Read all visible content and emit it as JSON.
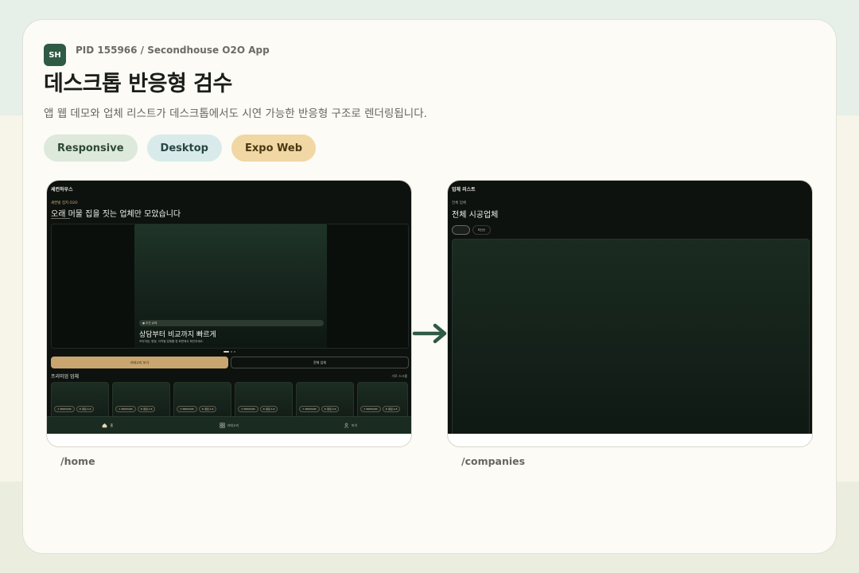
{
  "header": {
    "logo_text": "SH",
    "pid": "PID 155966 / Secondhouse O2O App",
    "title": "데스크톱 반응형 검수",
    "subtitle": "앱 웹 데모와 업체 리스트가 데스크톱에서도 시연 가능한 반응형 구조로 렌더링됩니다."
  },
  "chips": [
    {
      "label": "Responsive",
      "color": "#dde9da"
    },
    {
      "label": "Desktop",
      "color": "#d8ebea"
    },
    {
      "label": "Expo Web",
      "color": "#f0d7a4"
    }
  ],
  "home": {
    "route": "/home",
    "brand": "세컨하우스",
    "kicker": "세컨빌 집지 O2O",
    "headline": "오래 머물 집을 짓는 업체만 모았습니다",
    "hero": {
      "badge": "● 추천 큐레",
      "title": "상담부터 비교까지 빠르게",
      "subtitle": "프리미엄, 평점, 지역별 업체를 한 화면에서 확인하세요."
    },
    "buttons": {
      "category": "카테고리 보기",
      "all": "전체 업체"
    },
    "section_title": "프리미엄 업체",
    "section_more": "가로 스크롤",
    "cards": [
      {
        "badge1": "✦ PREMIUM",
        "badge2": "★ 평점 4.8"
      },
      {
        "badge1": "✦ PREMIUM",
        "badge2": "★ 평점 4.8"
      },
      {
        "badge1": "✦ PREMIUM",
        "badge2": "★ 평점 4.8"
      },
      {
        "badge1": "✦ PREMIUM",
        "badge2": "★ 평점 4.8"
      },
      {
        "badge1": "✦ PREMIUM",
        "badge2": "★ 평점 4.8"
      },
      {
        "badge1": "✦ PREMIUM",
        "badge2": "★ 평점 4.8"
      }
    ],
    "tabs": [
      {
        "label": "홈",
        "icon": "home-icon"
      },
      {
        "label": "카테고리",
        "icon": "grid-icon"
      },
      {
        "label": "마이",
        "icon": "user-icon"
      }
    ]
  },
  "companies": {
    "route": "/companies",
    "brand": "업체 리스트",
    "kicker": "전체 업체",
    "headline": "전체 시공업체",
    "filter_label": "최신순"
  }
}
